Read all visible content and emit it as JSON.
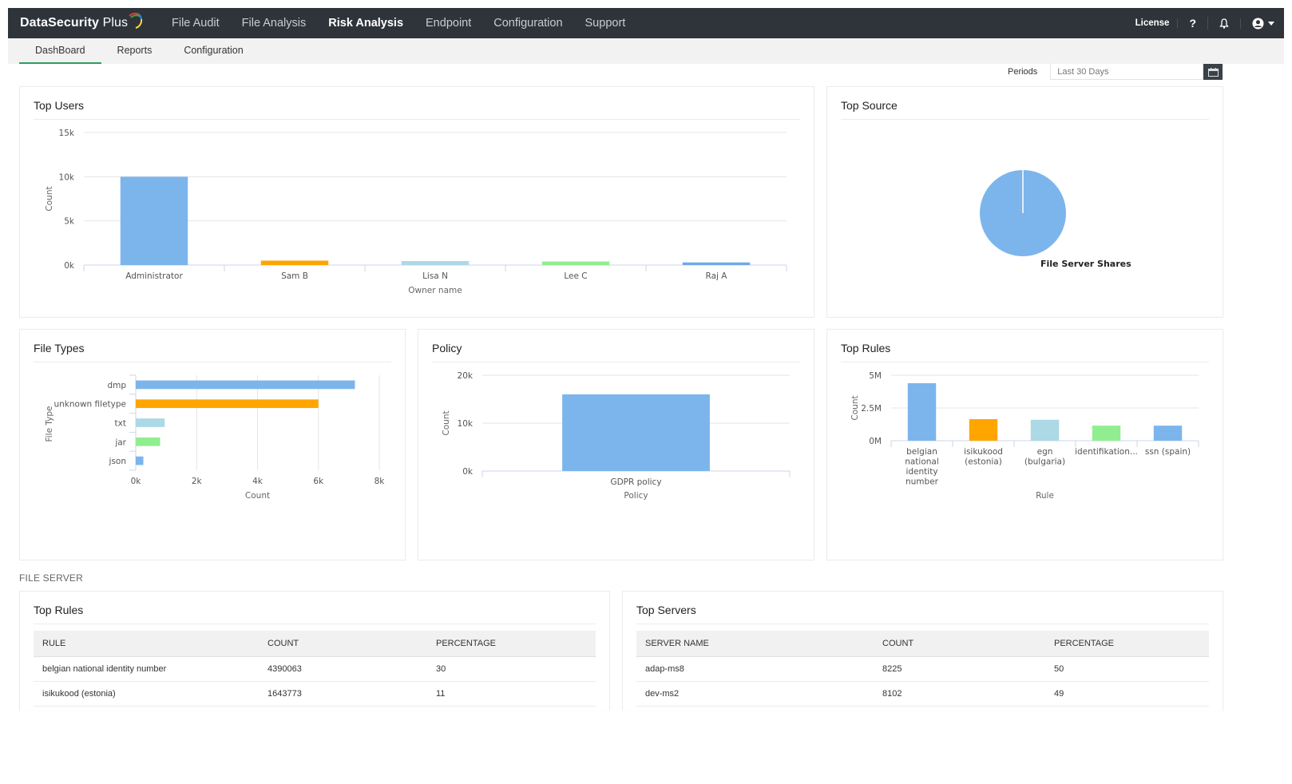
{
  "app": {
    "brand_name": "DataSecurity",
    "brand_suffix": "Plus"
  },
  "main_nav": [
    {
      "label": "File Audit",
      "active": false
    },
    {
      "label": "File Analysis",
      "active": false
    },
    {
      "label": "Risk Analysis",
      "active": true
    },
    {
      "label": "Endpoint",
      "active": false
    },
    {
      "label": "Configuration",
      "active": false
    },
    {
      "label": "Support",
      "active": false
    }
  ],
  "top_right": {
    "license_label": "License",
    "help_icon": "question-icon",
    "notification_icon": "bell-icon",
    "user_icon": "user-avatar-icon"
  },
  "sub_nav": [
    {
      "label": "DashBoard",
      "active": true
    },
    {
      "label": "Reports",
      "active": false
    },
    {
      "label": "Configuration",
      "active": false
    }
  ],
  "periods": {
    "label": "Periods",
    "value": "Last 30 Days",
    "icon": "calendar-icon"
  },
  "section_label": "FILE SERVER",
  "colors": {
    "blue": "#7cb5ec",
    "orange": "#ffa500",
    "lightblue": "#add8e6",
    "green": "#90ee90",
    "blue2": "#6ea8e8",
    "topbar": "#2f343b",
    "accent_green": "#2e9b5f"
  },
  "chart_data": [
    {
      "id": "top_users",
      "title": "Top Users",
      "type": "bar",
      "categories": [
        "Administrator",
        "Sam B",
        "Lisa N",
        "Lee C",
        "Raj A"
      ],
      "values": [
        10000,
        500,
        450,
        400,
        300
      ],
      "bar_colors": [
        "#7cb5ec",
        "#ffa500",
        "#add8e6",
        "#90ee90",
        "#6ea8e8"
      ],
      "xlabel": "Owner name",
      "ylabel": "Count",
      "ylim": [
        0,
        15000
      ],
      "yticks": [
        "0k",
        "5k",
        "10k",
        "15k"
      ],
      "grid": true
    },
    {
      "id": "top_source",
      "title": "Top Source",
      "type": "pie",
      "labels": [
        "File Server Shares"
      ],
      "values": [
        100
      ],
      "colors": [
        "#7cb5ec"
      ]
    },
    {
      "id": "file_types",
      "title": "File Types",
      "type": "bar",
      "orientation": "horizontal",
      "categories": [
        "dmp",
        "unknown filetype",
        "txt",
        "jar",
        "json"
      ],
      "values": [
        7200,
        6000,
        950,
        800,
        250
      ],
      "bar_colors": [
        "#7cb5ec",
        "#ffa500",
        "#add8e6",
        "#90ee90",
        "#7cb5ec"
      ],
      "xlabel": "Count",
      "ylabel": "File Type",
      "xlim": [
        0,
        8000
      ],
      "xticks": [
        "0k",
        "2k",
        "4k",
        "6k",
        "8k"
      ],
      "grid": true
    },
    {
      "id": "policy",
      "title": "Policy",
      "type": "bar",
      "categories": [
        "GDPR policy"
      ],
      "values": [
        16000
      ],
      "bar_colors": [
        "#7cb5ec"
      ],
      "xlabel": "Policy",
      "ylabel": "Count",
      "ylim": [
        0,
        20000
      ],
      "yticks": [
        "0k",
        "10k",
        "20k"
      ],
      "grid": true
    },
    {
      "id": "top_rules_chart",
      "title": "Top Rules",
      "type": "bar",
      "categories": [
        "belgian national identity number",
        "isikukood (estonia)",
        "egn (bulgaria)",
        "identifikation...",
        "ssn (spain)"
      ],
      "category_lines": [
        [
          "belgian",
          "national",
          "identity",
          "number"
        ],
        [
          "isikukood",
          "(estonia)"
        ],
        [
          "egn",
          "(bulgaria)"
        ],
        [
          "identifikation..."
        ],
        [
          "ssn (spain)"
        ]
      ],
      "values": [
        4390063,
        1643773,
        1600000,
        1150000,
        1150000
      ],
      "bar_colors": [
        "#7cb5ec",
        "#ffa500",
        "#add8e6",
        "#90ee90",
        "#7cb5ec"
      ],
      "xlabel": "Rule",
      "ylabel": "Count",
      "ylim": [
        0,
        5000000
      ],
      "yticks": [
        "0M",
        "2.5M",
        "5M"
      ],
      "grid": true
    }
  ],
  "tables": {
    "top_rules": {
      "title": "Top Rules",
      "columns": [
        "RULE",
        "COUNT",
        "PERCENTAGE"
      ],
      "rows": [
        [
          "belgian national identity number",
          "4390063",
          "30"
        ],
        [
          "isikukood (estonia)",
          "1643773",
          "11"
        ]
      ]
    },
    "top_servers": {
      "title": "Top Servers",
      "columns": [
        "SERVER NAME",
        "COUNT",
        "PERCENTAGE"
      ],
      "rows": [
        [
          "adap-ms8",
          "8225",
          "50"
        ],
        [
          "dev-ms2",
          "8102",
          "49"
        ]
      ]
    }
  }
}
